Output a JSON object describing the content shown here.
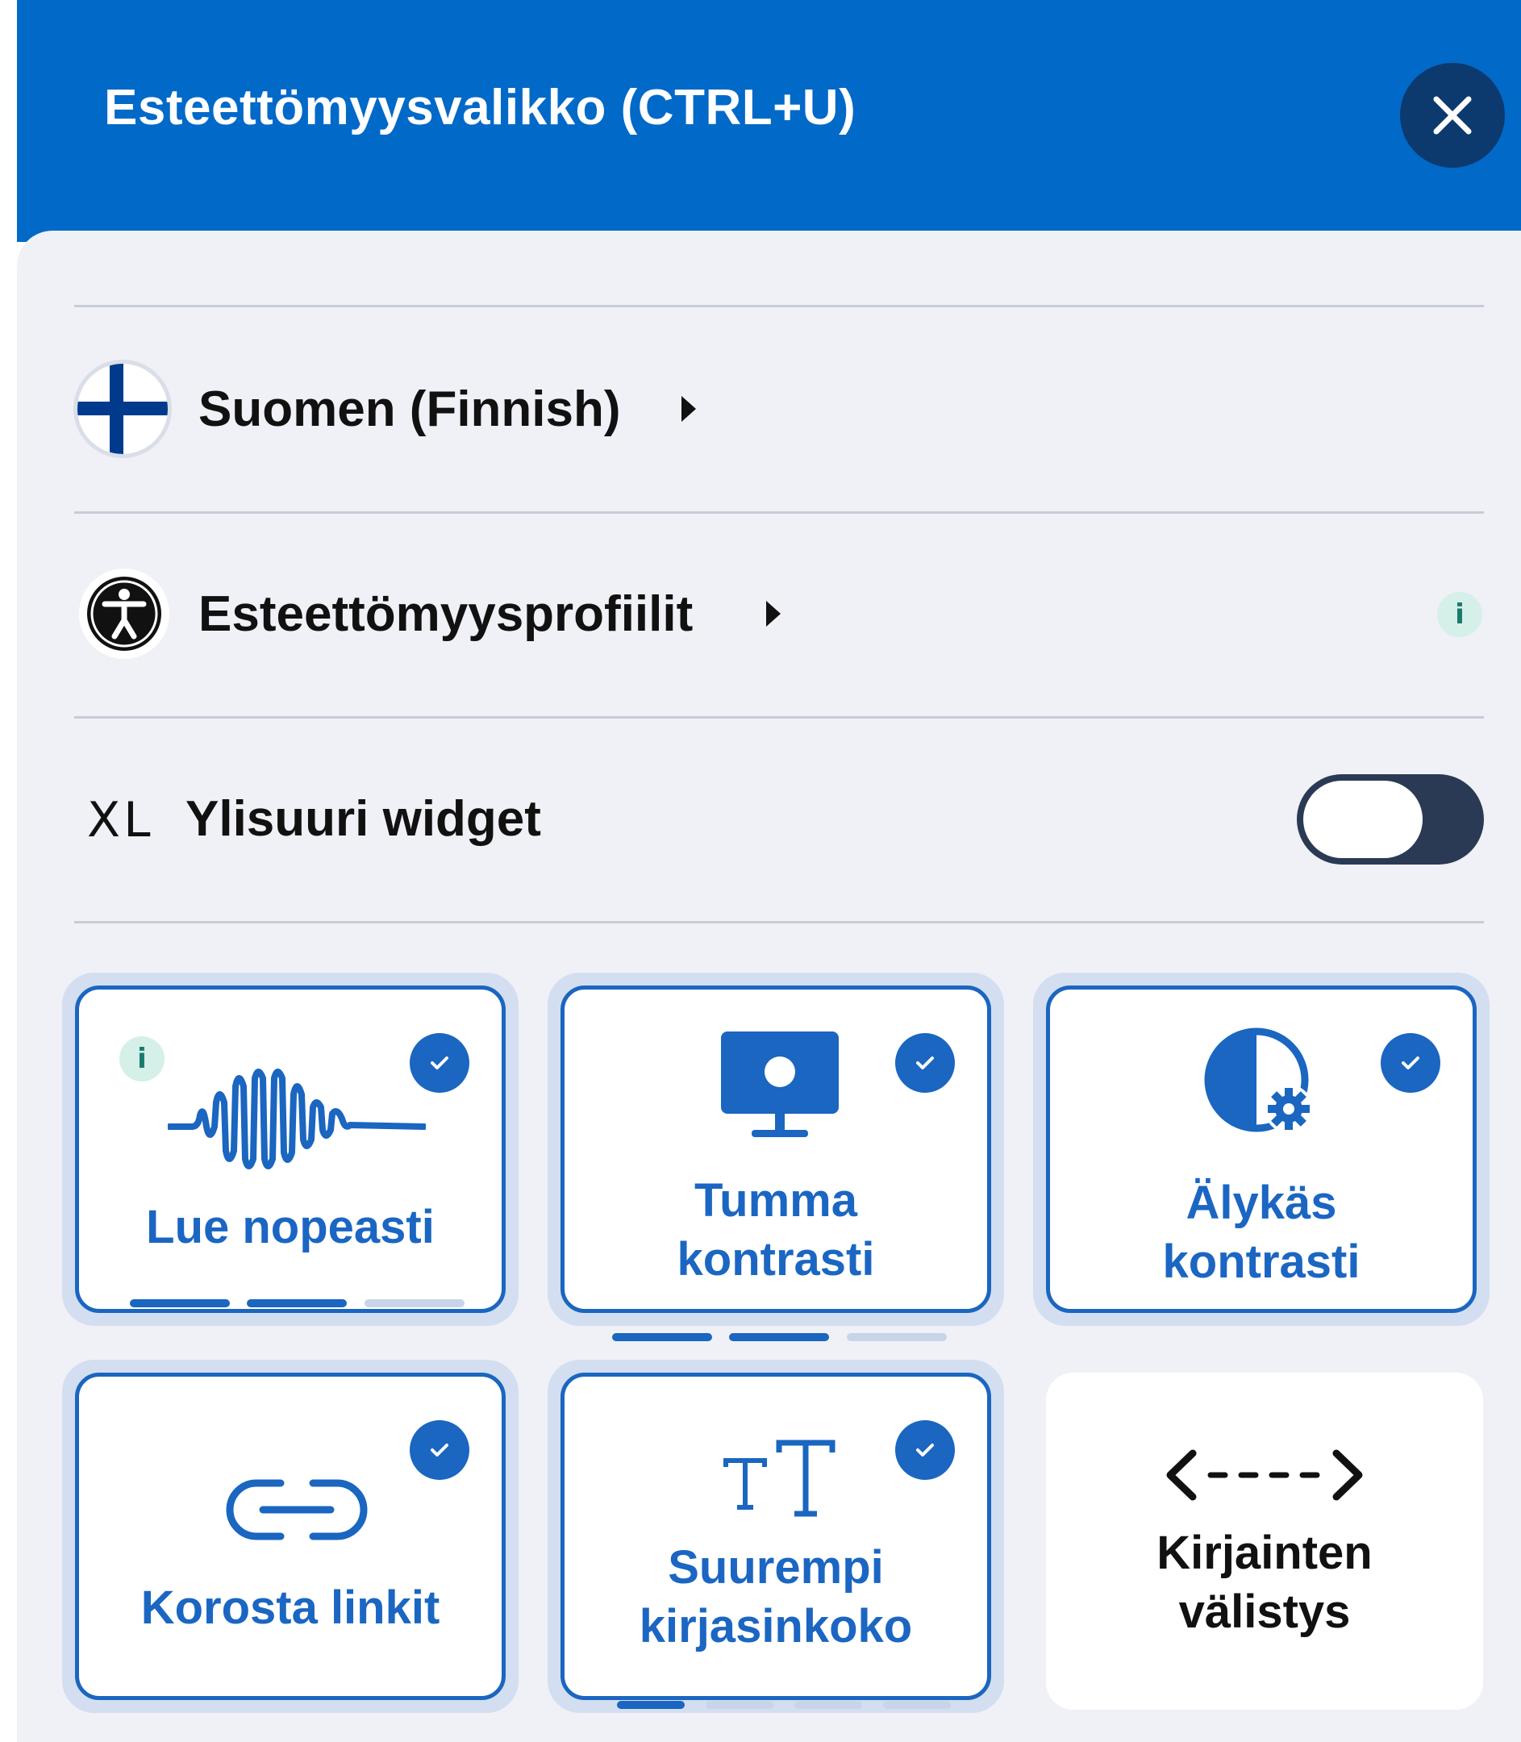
{
  "header": {
    "title": "Esteettömyysvalikko (CTRL+U)",
    "close_icon": "close-icon"
  },
  "language": {
    "label": "Suomen (Finnish)",
    "icon": "finland-flag-icon"
  },
  "profiles": {
    "label": "Esteettömyysprofiilit",
    "icon": "accessibility-person-icon",
    "info": "i"
  },
  "oversize": {
    "badge": "XL",
    "label": "Ylisuuri widget",
    "enabled": false
  },
  "cards": [
    {
      "label_lines": [
        "Lue nopeasti"
      ],
      "icon": "sound-wave-icon",
      "active": true,
      "info": "i",
      "levels": 3,
      "level": 2
    },
    {
      "label_lines": [
        "Tumma",
        "kontrasti"
      ],
      "icon": "monitor-icon",
      "active": true,
      "levels": 3,
      "level": 2
    },
    {
      "label_lines": [
        "Älykäs",
        "kontrasti"
      ],
      "icon": "half-circle-gear-icon",
      "active": true
    },
    {
      "label_lines": [
        "Korosta linkit"
      ],
      "icon": "link-icon",
      "active": true
    },
    {
      "label_lines": [
        "Suurempi",
        "kirjasinkoko"
      ],
      "icon": "text-size-icon",
      "active": true,
      "levels": 4,
      "level": 1
    },
    {
      "label_lines": [
        "Kirjainten",
        "välistys"
      ],
      "icon": "letter-spacing-arrows-icon",
      "active": false
    }
  ],
  "colors": {
    "header_bg": "#0169c8",
    "accent": "#1a66c0",
    "panel_bg": "#eff1f6"
  }
}
